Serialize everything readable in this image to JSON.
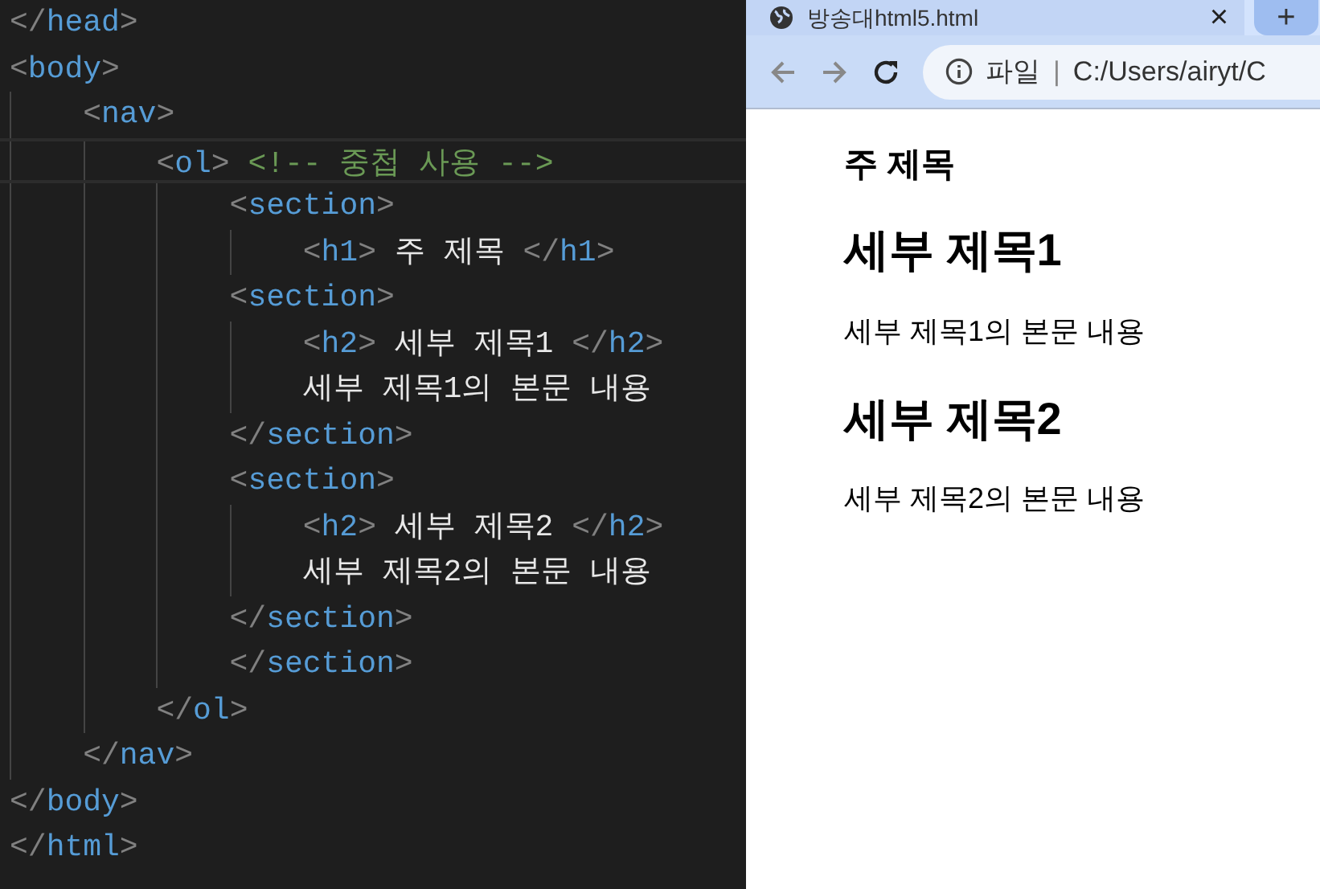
{
  "editor": {
    "lines": [
      {
        "current": false,
        "tokens": [
          {
            "kind": "bracket",
            "text": "</"
          },
          {
            "kind": "tag",
            "text": "head"
          },
          {
            "kind": "bracket",
            "text": ">"
          }
        ]
      },
      {
        "current": false,
        "tokens": [
          {
            "kind": "bracket",
            "text": "<"
          },
          {
            "kind": "tag",
            "text": "body"
          },
          {
            "kind": "bracket",
            "text": ">"
          }
        ],
        "children": [
          {
            "current": false,
            "tokens": [
              {
                "kind": "bracket",
                "text": "<"
              },
              {
                "kind": "tag",
                "text": "nav"
              },
              {
                "kind": "bracket",
                "text": ">"
              }
            ],
            "children": [
              {
                "current": true,
                "tokens": [
                  {
                    "kind": "bracket",
                    "text": "<"
                  },
                  {
                    "kind": "tag",
                    "text": "ol"
                  },
                  {
                    "kind": "bracket",
                    "text": ">"
                  },
                  {
                    "kind": "comment",
                    "text": " <!-- 중첩 사용 -->"
                  }
                ],
                "children": [
                  {
                    "current": false,
                    "tokens": [
                      {
                        "kind": "bracket",
                        "text": "<"
                      },
                      {
                        "kind": "tag",
                        "text": "section"
                      },
                      {
                        "kind": "bracket",
                        "text": ">"
                      }
                    ],
                    "children": [
                      {
                        "current": false,
                        "tokens": [
                          {
                            "kind": "bracket",
                            "text": "<"
                          },
                          {
                            "kind": "tag",
                            "text": "h1"
                          },
                          {
                            "kind": "bracket",
                            "text": ">"
                          },
                          {
                            "kind": "text",
                            "text": " 주 제목 "
                          },
                          {
                            "kind": "bracket",
                            "text": "</"
                          },
                          {
                            "kind": "tag",
                            "text": "h1"
                          },
                          {
                            "kind": "bracket",
                            "text": ">"
                          }
                        ]
                      }
                    ]
                  },
                  {
                    "current": false,
                    "tokens": [
                      {
                        "kind": "bracket",
                        "text": "<"
                      },
                      {
                        "kind": "tag",
                        "text": "section"
                      },
                      {
                        "kind": "bracket",
                        "text": ">"
                      }
                    ],
                    "children": [
                      {
                        "current": false,
                        "tokens": [
                          {
                            "kind": "bracket",
                            "text": "<"
                          },
                          {
                            "kind": "tag",
                            "text": "h2"
                          },
                          {
                            "kind": "bracket",
                            "text": ">"
                          },
                          {
                            "kind": "text",
                            "text": " 세부 제목1 "
                          },
                          {
                            "kind": "bracket",
                            "text": "</"
                          },
                          {
                            "kind": "tag",
                            "text": "h2"
                          },
                          {
                            "kind": "bracket",
                            "text": ">"
                          }
                        ]
                      },
                      {
                        "current": false,
                        "tokens": [
                          {
                            "kind": "text",
                            "text": "세부 제목1의 본문 내용"
                          }
                        ]
                      }
                    ]
                  },
                  {
                    "current": false,
                    "tokens": [
                      {
                        "kind": "bracket",
                        "text": "</"
                      },
                      {
                        "kind": "tag",
                        "text": "section"
                      },
                      {
                        "kind": "bracket",
                        "text": ">"
                      }
                    ]
                  },
                  {
                    "current": false,
                    "tokens": [
                      {
                        "kind": "bracket",
                        "text": "<"
                      },
                      {
                        "kind": "tag",
                        "text": "section"
                      },
                      {
                        "kind": "bracket",
                        "text": ">"
                      }
                    ],
                    "children": [
                      {
                        "current": false,
                        "tokens": [
                          {
                            "kind": "bracket",
                            "text": "<"
                          },
                          {
                            "kind": "tag",
                            "text": "h2"
                          },
                          {
                            "kind": "bracket",
                            "text": ">"
                          },
                          {
                            "kind": "text",
                            "text": " 세부 제목2 "
                          },
                          {
                            "kind": "bracket",
                            "text": "</"
                          },
                          {
                            "kind": "tag",
                            "text": "h2"
                          },
                          {
                            "kind": "bracket",
                            "text": ">"
                          }
                        ]
                      },
                      {
                        "current": false,
                        "tokens": [
                          {
                            "kind": "text",
                            "text": "세부 제목2의 본문 내용"
                          }
                        ]
                      }
                    ]
                  },
                  {
                    "current": false,
                    "tokens": [
                      {
                        "kind": "bracket",
                        "text": "</"
                      },
                      {
                        "kind": "tag",
                        "text": "section"
                      },
                      {
                        "kind": "bracket",
                        "text": ">"
                      }
                    ]
                  },
                  {
                    "current": false,
                    "tokens": [
                      {
                        "kind": "bracket",
                        "text": "</"
                      },
                      {
                        "kind": "tag",
                        "text": "section"
                      },
                      {
                        "kind": "bracket",
                        "text": ">"
                      }
                    ]
                  }
                ]
              },
              {
                "current": false,
                "tokens": [
                  {
                    "kind": "bracket",
                    "text": "</"
                  },
                  {
                    "kind": "tag",
                    "text": "ol"
                  },
                  {
                    "kind": "bracket",
                    "text": ">"
                  }
                ]
              }
            ]
          },
          {
            "current": false,
            "tokens": [
              {
                "kind": "bracket",
                "text": "</"
              },
              {
                "kind": "tag",
                "text": "nav"
              },
              {
                "kind": "bracket",
                "text": ">"
              }
            ]
          }
        ]
      },
      {
        "current": false,
        "tokens": [
          {
            "kind": "bracket",
            "text": "</"
          },
          {
            "kind": "tag",
            "text": "body"
          },
          {
            "kind": "bracket",
            "text": ">"
          }
        ]
      },
      {
        "current": false,
        "tokens": [
          {
            "kind": "bracket",
            "text": "</"
          },
          {
            "kind": "tag",
            "text": "html"
          },
          {
            "kind": "bracket",
            "text": ">"
          }
        ]
      }
    ]
  },
  "browser": {
    "tab": {
      "title": "방송대html5.html",
      "close": "×"
    },
    "new_tab": "+",
    "address": {
      "scheme": "파일",
      "separator": "|",
      "url": "C:/Users/airyt/C"
    },
    "content": [
      {
        "kind": "h1",
        "text": "주 제목"
      },
      {
        "kind": "h2",
        "text": "세부 제목1"
      },
      {
        "kind": "p",
        "text": "세부 제목1의 본문 내용"
      },
      {
        "kind": "h2",
        "text": "세부 제목2"
      },
      {
        "kind": "p",
        "text": "세부 제목2의 본문 내용"
      }
    ]
  }
}
